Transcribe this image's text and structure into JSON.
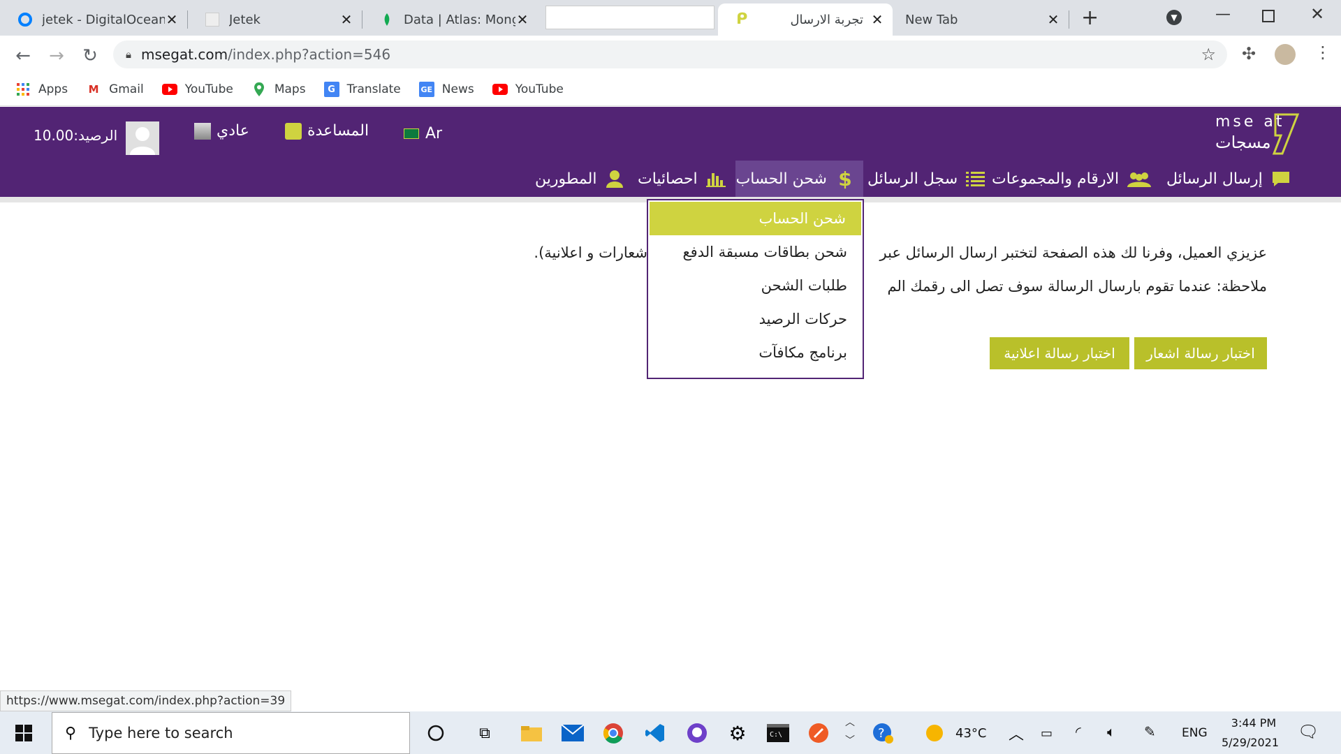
{
  "browser": {
    "tabs": [
      {
        "title": "jetek - DigitalOcean",
        "close": "✕"
      },
      {
        "title": "Jetek",
        "close": "✕"
      },
      {
        "title": "Data | Atlas: MongoD",
        "close": "✕"
      },
      {
        "title": "تجربة الارسال",
        "close": "✕"
      },
      {
        "title": "New Tab",
        "close": "✕"
      }
    ],
    "new_tab": "+",
    "url_host": "msegat.com",
    "url_path": "/index.php?action=546",
    "bookmarks": [
      "Apps",
      "Gmail",
      "YouTube",
      "Maps",
      "Translate",
      "News",
      "YouTube"
    ],
    "status_url": "https://www.msegat.com/index.php?action=39"
  },
  "site": {
    "logo_latin": "mse at",
    "logo_arabic": "مسجات",
    "lang": "Ar",
    "help": "المساعدة",
    "account_type": "عادي",
    "balance": "الرصيد:10.00",
    "menu": {
      "send": "إرسال الرسائل",
      "numbers": "الارقام والمجموعات",
      "log": "سجل الرسائل",
      "billing": "شحن الحساب",
      "stats": "احصائيات",
      "developers": "المطورين"
    },
    "dropdown": [
      "شحن الحساب",
      "شحن بطاقات مسبقة الدفع",
      "طلبات الشحن",
      "حركات الرصيد",
      "برنامج مكافآت"
    ],
    "line1_right": "عزيزي العميل، وفرنا لك هذه الصفحة لتختبر ارسال الرسائل عبر",
    "line1_left": "شعارات و اعلانية).",
    "line2": "ملاحظة: عندما تقوم بارسال الرسالة سوف تصل الى رقمك الم",
    "btn_notice": "اختبار رسالة اشعار",
    "btn_ad": "اختبار رسالة اعلانية"
  },
  "taskbar": {
    "search_placeholder": "Type here to search",
    "temp": "43°C",
    "lang": "ENG",
    "time": "3:44 PM",
    "date": "5/29/2021"
  }
}
